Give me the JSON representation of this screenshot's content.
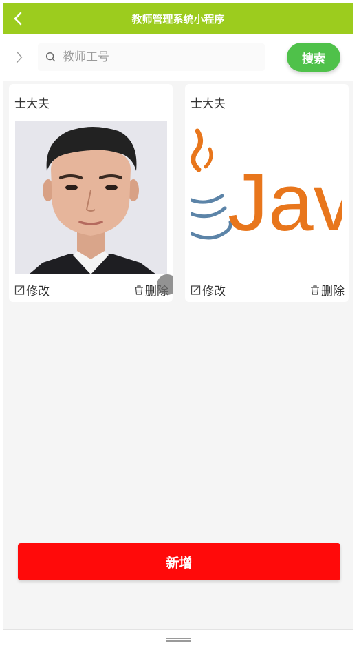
{
  "navbar": {
    "title": "教师管理系统小程序"
  },
  "search": {
    "placeholder": "教师工号",
    "button_label": "搜索"
  },
  "cards": [
    {
      "name": "士大夫",
      "edit_label": "修改",
      "delete_label": "删除",
      "image": "portrait-photo"
    },
    {
      "name": "士大夫",
      "edit_label": "修改",
      "delete_label": "删除",
      "image": "java-logo"
    }
  ],
  "java_logo_text": "Jav",
  "add_button": {
    "label": "新增"
  },
  "colors": {
    "navbar": "#9ccc1e",
    "search_button": "#4fc14a",
    "add_button": "#ff0a0a",
    "java_orange": "#e8761c",
    "java_steel": "#5c84a8"
  }
}
